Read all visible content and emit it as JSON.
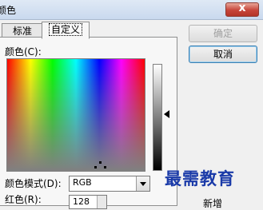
{
  "window": {
    "title": "颜色",
    "close_label": "x"
  },
  "tabs": [
    {
      "label": "标准",
      "selected": false
    },
    {
      "label": "自定义",
      "selected": true
    }
  ],
  "custom": {
    "colors_label": "颜色(C):",
    "color_mode_label": "颜色模式(D):",
    "color_mode_value": "RGB",
    "red_label": "红色(R):",
    "red_value": "128"
  },
  "buttons": {
    "ok": "确定",
    "cancel": "取消"
  },
  "preview": {
    "new_label": "新增"
  },
  "watermark": "最需教育",
  "colors": {
    "title_gradient_top": "#dfe9f5",
    "close_red": "#c7453a",
    "watermark": "#1a3aa8"
  }
}
